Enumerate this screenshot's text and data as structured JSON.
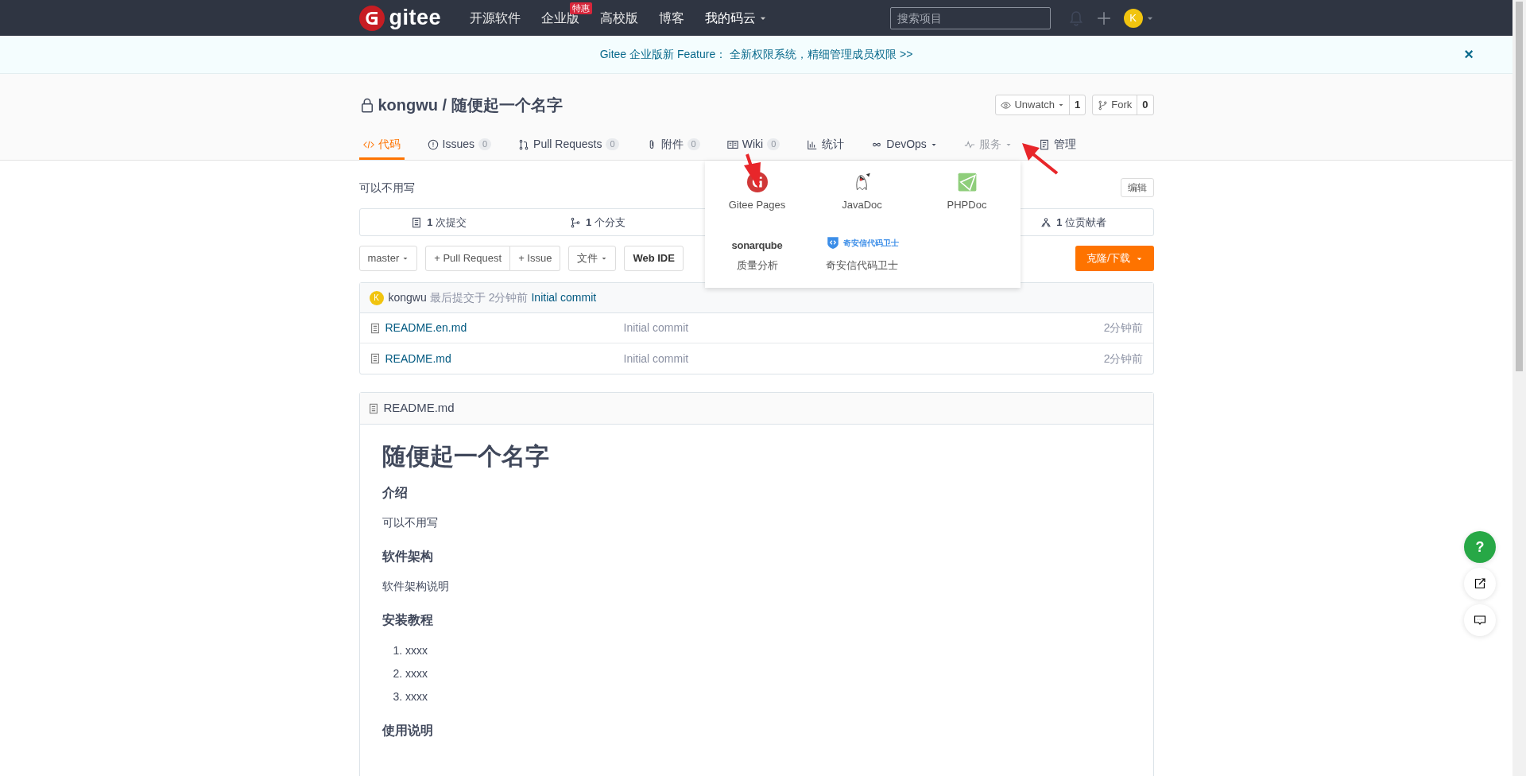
{
  "navbar": {
    "logo": "gitee",
    "links": [
      {
        "label": "开源软件",
        "dropdown": false
      },
      {
        "label": "企业版",
        "badge": "特惠",
        "dropdown": false
      },
      {
        "label": "高校版",
        "dropdown": false
      },
      {
        "label": "博客",
        "dropdown": false
      },
      {
        "label": "我的码云",
        "dropdown": true
      }
    ],
    "search": {
      "placeholder": "搜索项目"
    },
    "avatar": "K"
  },
  "banner": {
    "text": "Gitee 企业版新 Feature： 全新权限系统，精细管理成员权限 >>",
    "close": "×"
  },
  "repo": {
    "owner": "kongwu",
    "separator": "/",
    "name": "随便起一个名字",
    "watch": {
      "label": "Unwatch",
      "count": "1"
    },
    "fork": {
      "label": "Fork",
      "count": "0"
    }
  },
  "tabs": [
    {
      "kind": "code",
      "label": "代码",
      "selected": true,
      "hovered": false,
      "dropdown": false
    },
    {
      "kind": "issues",
      "label": "Issues",
      "count": "0",
      "selected": false,
      "hovered": false,
      "dropdown": false
    },
    {
      "kind": "pulls",
      "label": "Pull Requests",
      "count": "0",
      "selected": false,
      "hovered": false,
      "dropdown": false
    },
    {
      "kind": "attach",
      "label": "附件",
      "count": "0",
      "selected": false,
      "hovered": false,
      "dropdown": false
    },
    {
      "kind": "wiki",
      "label": "Wiki",
      "count": "0",
      "selected": false,
      "hovered": false,
      "dropdown": false
    },
    {
      "kind": "stats",
      "label": "统计",
      "selected": false,
      "hovered": false,
      "dropdown": false
    },
    {
      "kind": "devops",
      "label": "DevOps",
      "selected": false,
      "hovered": false,
      "dropdown": true
    },
    {
      "kind": "service",
      "label": "服务",
      "selected": false,
      "hovered": true,
      "dropdown": true
    },
    {
      "kind": "manage",
      "label": "管理",
      "selected": false,
      "hovered": false,
      "dropdown": false
    }
  ],
  "services_menu": [
    {
      "kind": "pages",
      "label": "Gitee Pages"
    },
    {
      "kind": "javadoc",
      "label": "JavaDoc"
    },
    {
      "kind": "phpdoc",
      "label": "PHPDoc"
    },
    {
      "kind": "sonar",
      "label": "质量分析",
      "logo": "sonarqube"
    },
    {
      "kind": "qianxin",
      "label": "奇安信代码卫士",
      "logo": "奇安信代码卫士"
    }
  ],
  "description": "可以不用写",
  "edit_button": "编辑",
  "stats": [
    {
      "kind": "commits",
      "count": "1",
      "label": "次提交"
    },
    {
      "kind": "branches",
      "count": "1",
      "label": "个分支"
    },
    {
      "kind": "contributors",
      "count": "1",
      "label": "位贡献者"
    }
  ],
  "toolbar": {
    "branch": "master",
    "pull_request": "+ Pull Request",
    "issue": "+ Issue",
    "files": "文件",
    "web_ide": "Web IDE",
    "clone": "克隆/下载"
  },
  "last_commit": {
    "avatar": "K",
    "author": "kongwu",
    "text": "最后提交于 2分钟前",
    "message": "Initial commit"
  },
  "files": [
    {
      "name": "README.en.md",
      "message": "Initial commit",
      "time": "2分钟前"
    },
    {
      "name": "README.md",
      "message": "Initial commit",
      "time": "2分钟前"
    }
  ],
  "readme": {
    "filename": "README.md",
    "blocks": [
      {
        "kind": "h1",
        "text": "随便起一个名字"
      },
      {
        "kind": "h3",
        "text": "介绍"
      },
      {
        "kind": "p",
        "text": "可以不用写"
      },
      {
        "kind": "h3",
        "text": "软件架构"
      },
      {
        "kind": "p",
        "text": "软件架构说明"
      },
      {
        "kind": "h3",
        "text": "安装教程"
      },
      {
        "kind": "ol",
        "items": [
          {
            "marker": "1.",
            "text": "xxxx"
          },
          {
            "marker": "2.",
            "text": "xxxx"
          },
          {
            "marker": "3.",
            "text": "xxxx"
          }
        ]
      },
      {
        "kind": "h3",
        "text": "使用说明"
      }
    ]
  },
  "help_button": "?"
}
